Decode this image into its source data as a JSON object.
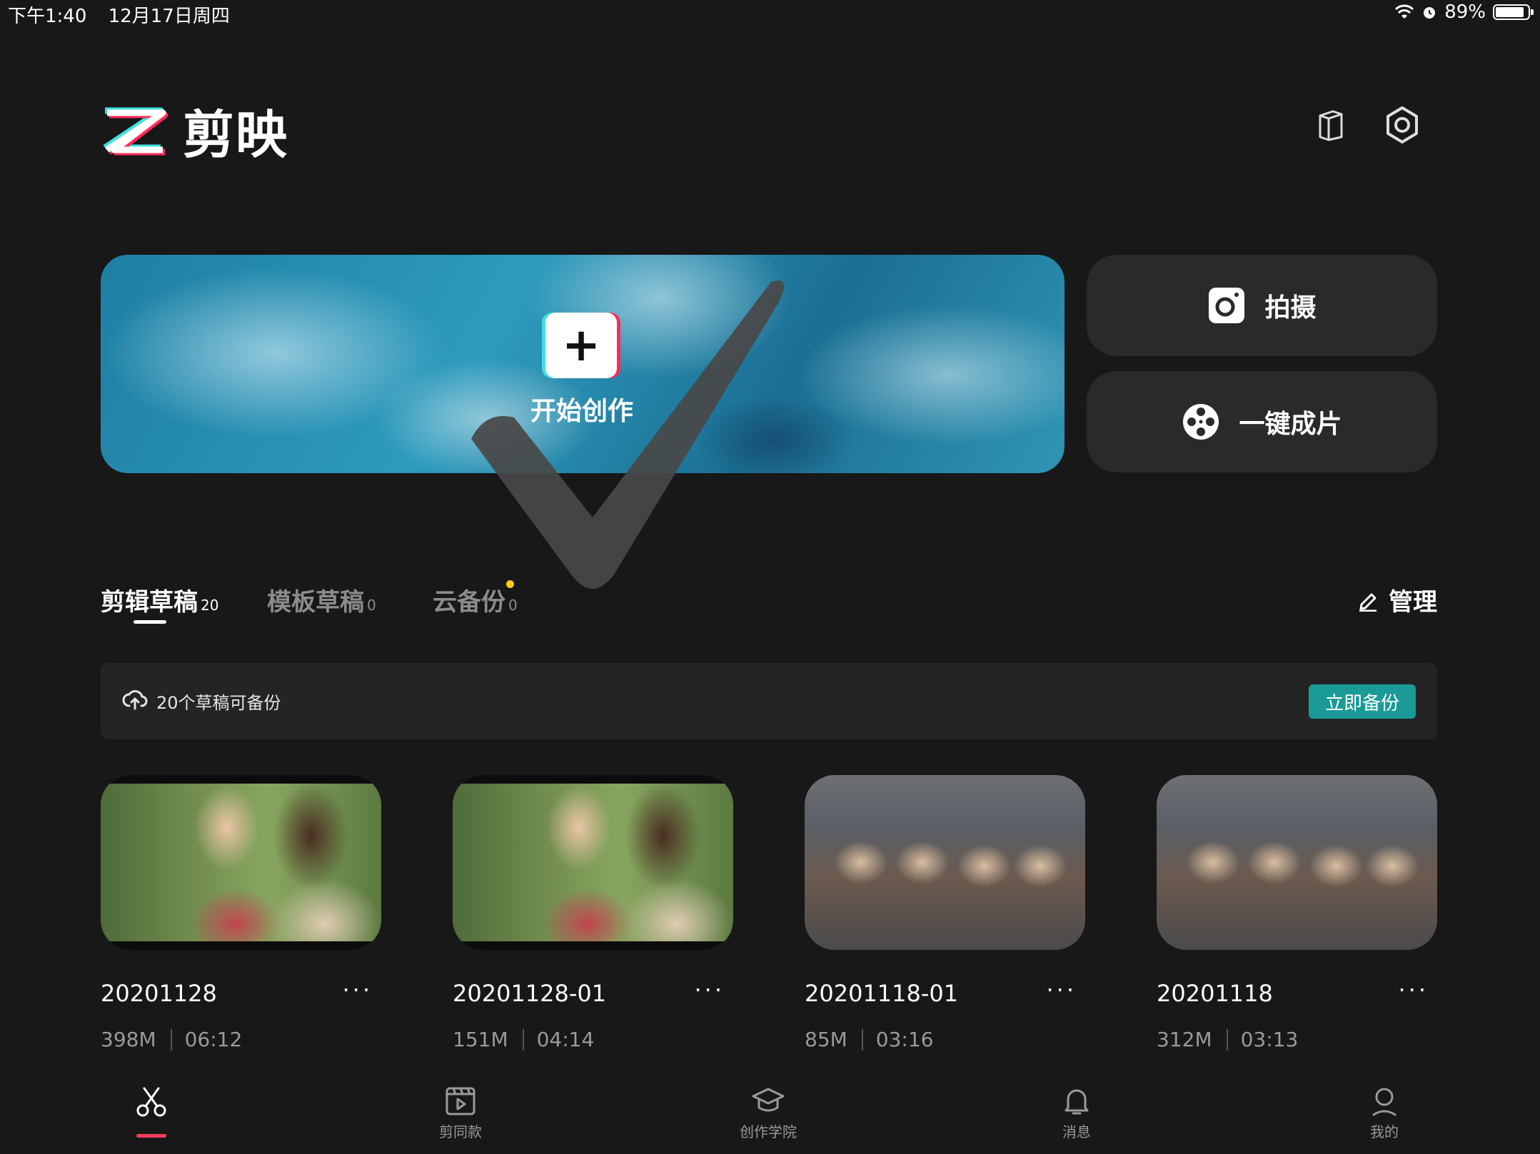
{
  "status_bar": {
    "time": "下午1:40",
    "date": "12月17日周四",
    "battery": "89%",
    "battery_level": 0.89
  },
  "header": {
    "app_name": "剪映"
  },
  "hero": {
    "label": "开始创作",
    "plus": "+"
  },
  "side_actions": [
    {
      "label": "拍摄"
    },
    {
      "label": "一键成片"
    }
  ],
  "tabs": [
    {
      "label": "剪辑草稿",
      "count": "20"
    },
    {
      "label": "模板草稿",
      "count": "0"
    },
    {
      "label": "云备份",
      "count": "0"
    }
  ],
  "manage_label": "管理",
  "banner": {
    "text": "20个草稿可备份",
    "button": "立即备份"
  },
  "drafts": [
    {
      "name": "20201128",
      "size": "398M",
      "duration": "06:12",
      "more": "···"
    },
    {
      "name": "20201128-01",
      "size": "151M",
      "duration": "04:14",
      "more": "···"
    },
    {
      "name": "20201118-01",
      "size": "85M",
      "duration": "03:16",
      "more": "···"
    },
    {
      "name": "20201118",
      "size": "312M",
      "duration": "03:13",
      "more": "···"
    }
  ],
  "nav": [
    {
      "label": "",
      "icon": "scissors-icon"
    },
    {
      "label": "剪同款",
      "icon": "template-icon"
    },
    {
      "label": "创作学院",
      "icon": "academy-icon"
    },
    {
      "label": "消息",
      "icon": "bell-icon"
    },
    {
      "label": "我的",
      "icon": "profile-icon"
    }
  ],
  "colors": {
    "background": "#181818",
    "accent": "#1a9b97",
    "active_nav": "#ff3b5c",
    "dot": "#ffcc1a"
  }
}
